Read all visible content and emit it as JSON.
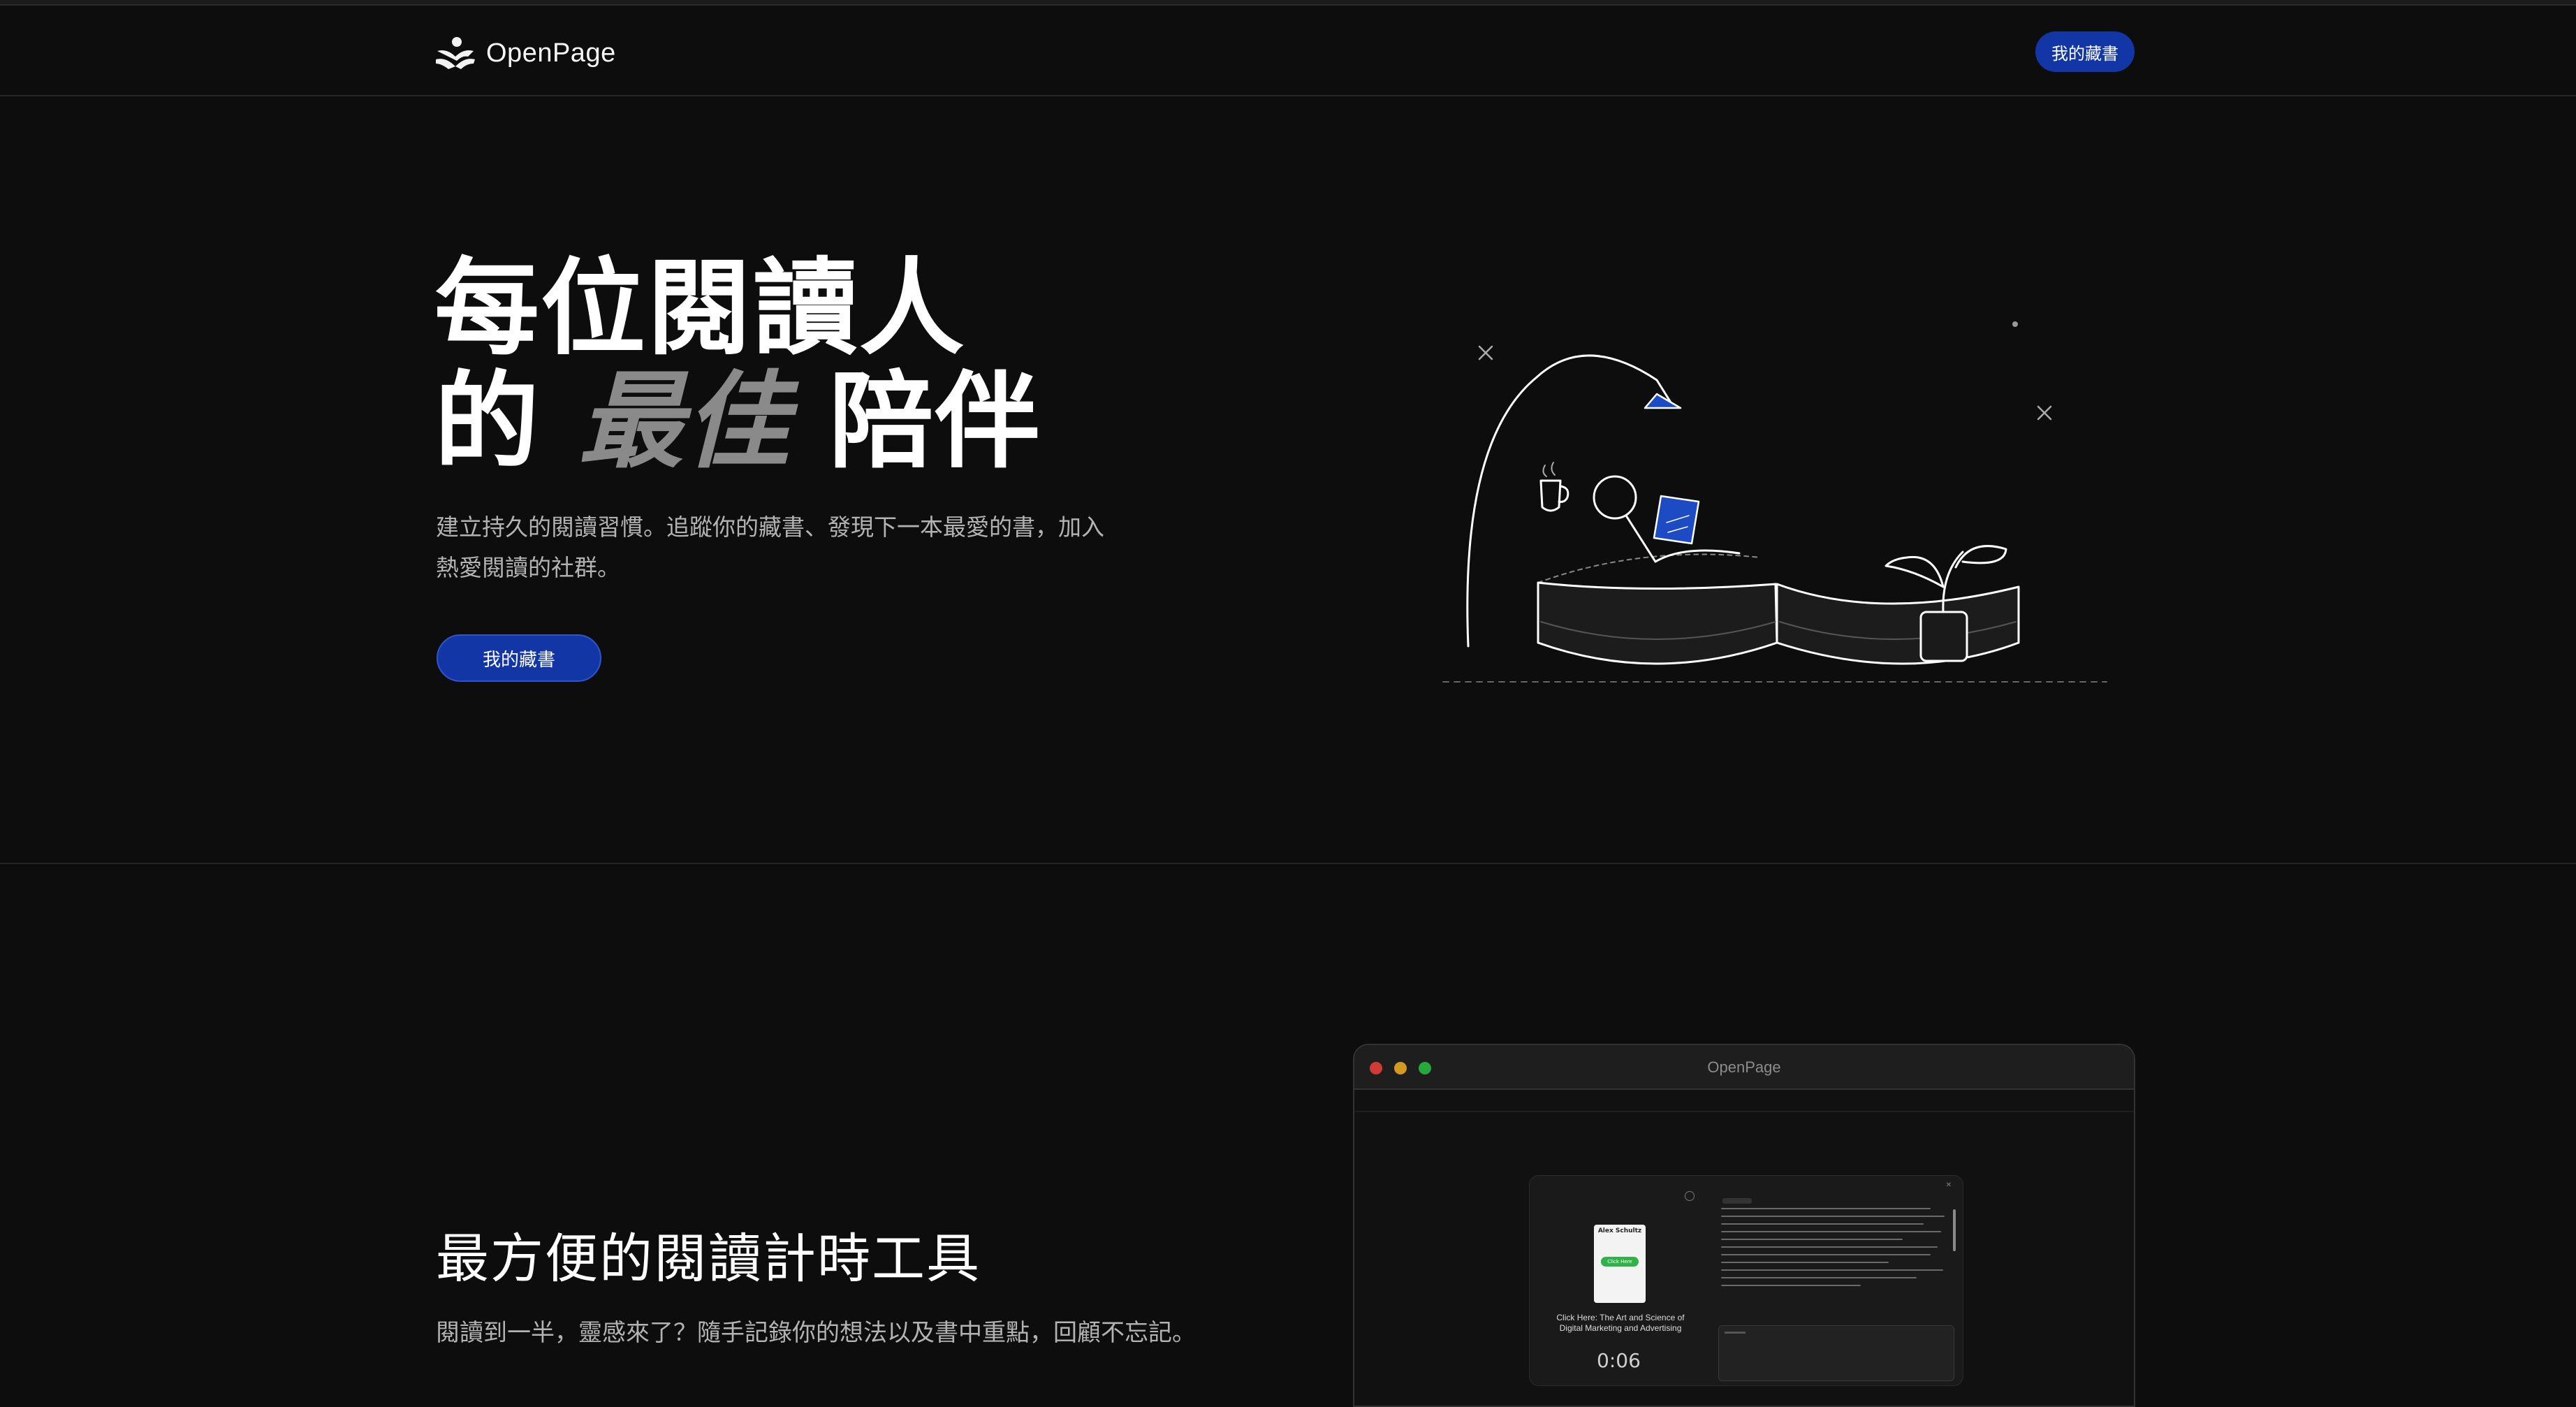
{
  "header": {
    "brand_name": "OpenPage",
    "nav_button_label": "我的藏書"
  },
  "hero": {
    "title_line1": "每位閱讀人",
    "title_line2_prefix": "的",
    "title_line2_emphasis": "最佳",
    "title_line2_suffix": "陪伴",
    "description_line1": "建立持久的閱讀習慣。追蹤你的藏書、發現下一本最愛的書，加入",
    "description_line2": "熱愛閱讀的社群。",
    "cta_label": "我的藏書"
  },
  "feature": {
    "title": "最方便的閱讀計時工具",
    "description": "閱讀到一半，靈感來了？隨手記錄你的想法以及書中重點，回顧不忘記。",
    "window_title": "OpenPage",
    "app": {
      "cover_author": "Alex Schultz",
      "cover_button": "Click Here",
      "book_title_line1": "Click Here: The Art and Science of",
      "book_title_line2": "Digital Marketing and Advertising",
      "timer": "0:06"
    }
  },
  "colors": {
    "background": "#0d0d0d",
    "accent": "#1236a6",
    "text_muted": "#b3b3b3",
    "emphasis_gray": "#8a8a8a"
  },
  "icons": {
    "brand": "reader-logo-icon",
    "window_controls": [
      "close-dot-icon",
      "minimize-dot-icon",
      "maximize-dot-icon"
    ]
  }
}
